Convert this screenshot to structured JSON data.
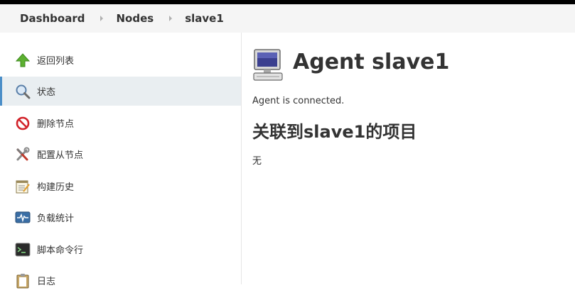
{
  "breadcrumbs": [
    "Dashboard",
    "Nodes",
    "slave1"
  ],
  "sidebar": {
    "items": [
      {
        "label": "返回列表",
        "icon": "up-arrow-icon"
      },
      {
        "label": "状态",
        "icon": "magnifier-icon"
      },
      {
        "label": "删除节点",
        "icon": "no-entry-icon"
      },
      {
        "label": "配置从节点",
        "icon": "tools-icon"
      },
      {
        "label": "构建历史",
        "icon": "notepad-icon"
      },
      {
        "label": "负载统计",
        "icon": "monitor-graph-icon"
      },
      {
        "label": "脚本命令行",
        "icon": "terminal-icon"
      },
      {
        "label": "日志",
        "icon": "clipboard-icon"
      }
    ],
    "active_index": 1
  },
  "main": {
    "title": "Agent slave1",
    "title_icon": "computer-icon",
    "status": "Agent is connected.",
    "projects_heading": "关联到slave1的项目",
    "projects_empty": "无"
  },
  "colors": {
    "topbar": "#000000",
    "breadcrumb_bg": "#f5f5f5",
    "active_bg": "#e9eef1",
    "active_border": "#4b8ec8"
  }
}
